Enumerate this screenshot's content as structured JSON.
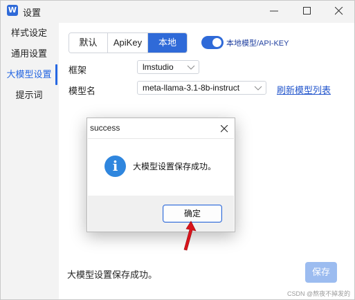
{
  "window": {
    "title": "设置",
    "app_icon_letter": "W",
    "controls": {
      "minimize": "minimize-icon",
      "maximize": "maximize-icon",
      "close": "close-icon"
    }
  },
  "sidebar": {
    "items": [
      {
        "label": "样式设定",
        "active": false
      },
      {
        "label": "通用设置",
        "active": false
      },
      {
        "label": "大模型设置",
        "active": true
      },
      {
        "label": "提示词",
        "active": false
      }
    ]
  },
  "tabs": [
    {
      "label": "默认",
      "active": false
    },
    {
      "label": "ApiKey",
      "active": false
    },
    {
      "label": "本地",
      "active": true
    }
  ],
  "toggle": {
    "label": "本地模型/API-KEY",
    "on": true
  },
  "fields": {
    "framework_label": "框架",
    "framework_value": "lmstudio",
    "model_label": "模型名",
    "model_value": "meta-llama-3.1-8b-instruct",
    "refresh_link": "刷新模型列表"
  },
  "footer": {
    "status_text": "大模型设置保存成功。",
    "save_label": "保存"
  },
  "dialog": {
    "title": "success",
    "message": "大模型设置保存成功。",
    "ok_label": "确定",
    "icon": "info-icon"
  },
  "watermark": "CSDN @熬夜不掉发的",
  "colors": {
    "accent": "#2f6ad8",
    "link": "#2255cc",
    "save_disabled": "#9cbcf0",
    "arrow": "#d9141c"
  }
}
